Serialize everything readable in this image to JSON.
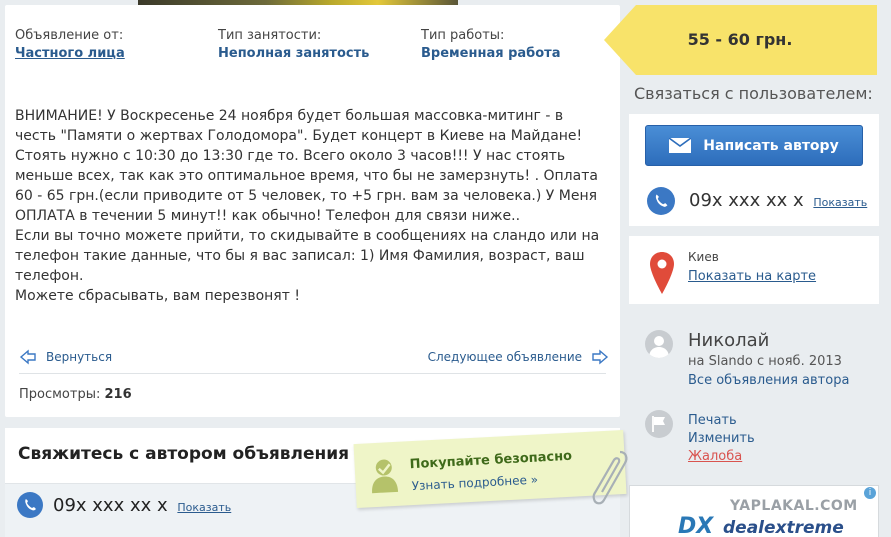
{
  "meta": {
    "from_label": "Объявление от:",
    "from_value": "Частного лица",
    "employment_label": "Тип занятости:",
    "employment_value": "Неполная занятость",
    "work_label": "Тип работы:",
    "work_value": "Временная работа"
  },
  "description": [
    "ВНИМАНИЕ! У Воскресенье 24 ноября будет большая массовка-митинг - в честь \"Памяти о жертвах Голодомора\". Будет концерт в Киеве на Майдане! Стоять нужно с 10:30 до 13:30 где то. Всего около 3 часов!!! У нас стоять меньше всех, так как это оптимальное время, что бы не замерзнуть! . Оплата 60 - 65 грн.(если приводите от 5 человек, то +5 грн. вам за человека.) У Меня ОПЛАТА в течении 5 минут!! как обычно! Телефон для связи ниже..",
    "Если вы точно можете прийти, то скидывайте в сообщениях на сландо или на телефон такие данные, что бы я вас записал: 1) Имя Фамилия, возраст, ваш телефон.",
    "Можете сбрасывать, вам перезвонят !"
  ],
  "nav": {
    "back_label": "Вернуться",
    "next_label": "Следующее объявление"
  },
  "views": {
    "label": "Просмотры:",
    "count": "216"
  },
  "price": "55 - 60 грн.",
  "contact": {
    "title": "Связаться с пользователем:",
    "write_button": "Написать автору",
    "phone": "09x xxx xx x",
    "show_label": "Показать"
  },
  "location": {
    "city": "Киев",
    "map_link": "Показать на карте"
  },
  "user": {
    "name": "Николай",
    "since": "на Slando с нояб. 2013",
    "all_ads": "Все объявления автора"
  },
  "actions": {
    "print": "Печать",
    "edit": "Изменить",
    "complaint": "Жалоба"
  },
  "bottom_contact": {
    "title": "Свяжитесь с автором объявления",
    "phone": "09x xxx xx x",
    "show_label": "Показать"
  },
  "safe_buy": {
    "title": "Покупайте безопасно",
    "more": "Узнать подробнее »"
  },
  "ad": {
    "watermark": "YAPLAKAL.COM",
    "brand_dx": "DX",
    "brand_name": "dealextreme",
    "info": "i"
  },
  "colors": {
    "link": "#2a5b8e",
    "button": "#2d6dbb",
    "price_tag": "#f8e36a",
    "background": "#e9edf0"
  }
}
